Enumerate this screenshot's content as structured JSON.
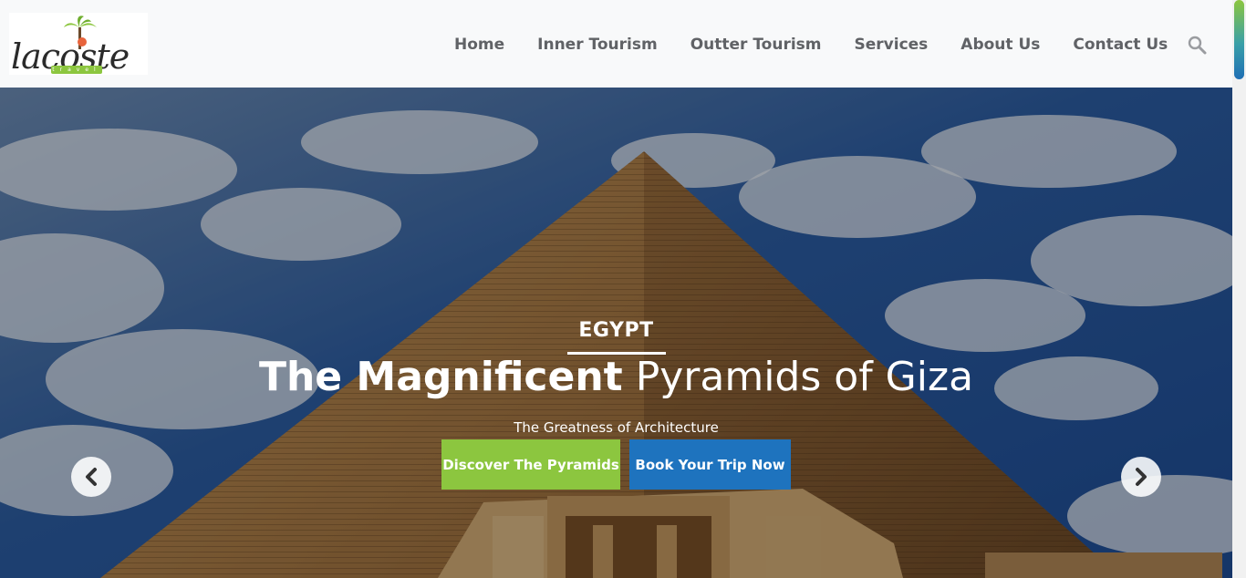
{
  "header": {
    "logo": {
      "text": "lacoste",
      "subtext": "travel"
    },
    "nav": [
      {
        "label": "Home"
      },
      {
        "label": "Inner Tourism"
      },
      {
        "label": "Outter Tourism"
      },
      {
        "label": "Services"
      },
      {
        "label": "About Us"
      },
      {
        "label": "Contact Us"
      }
    ],
    "search_icon": "search-icon"
  },
  "hero": {
    "kicker": "EGYPT",
    "headline_strong": "The Magnificent",
    "headline_light": "Pyramids of Giza",
    "subline": "The Greatness of Architecture",
    "buttons": {
      "primary": "Discover The Pyramids",
      "secondary": "Book Your Trip Now"
    },
    "prev_icon": "chevron-left-icon",
    "next_icon": "chevron-right-icon"
  },
  "colors": {
    "brand_green": "#8cc63f",
    "brand_blue": "#1e73be",
    "nav_text": "#606266",
    "header_bg": "#f8f9fa"
  }
}
